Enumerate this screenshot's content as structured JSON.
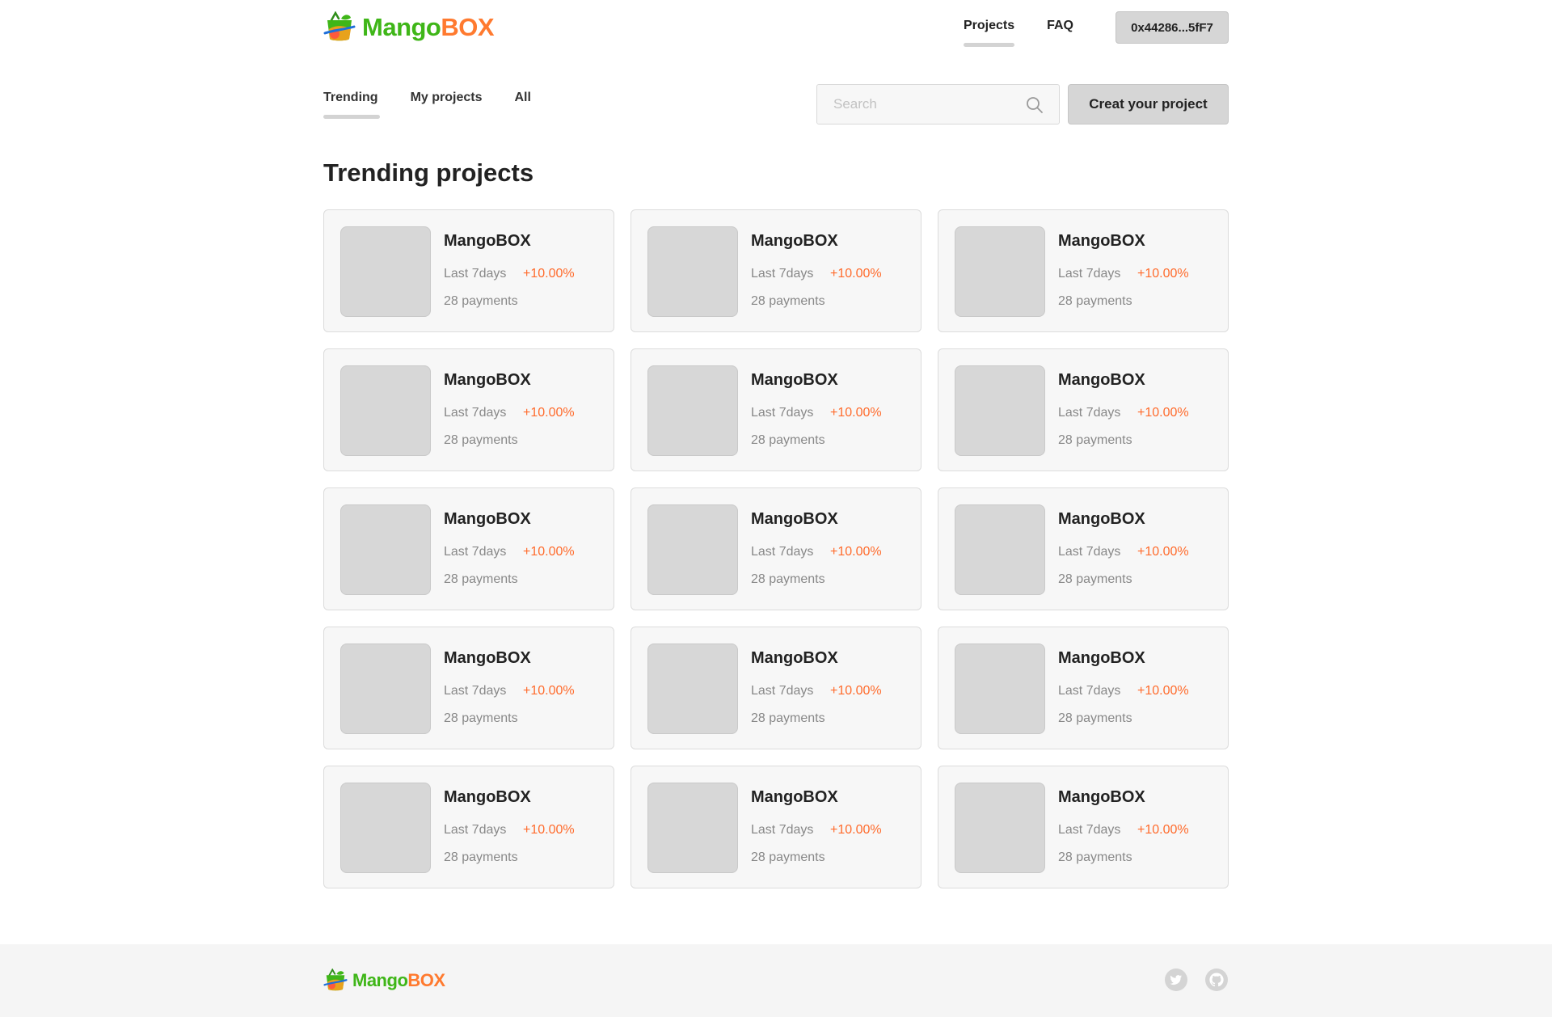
{
  "brand": {
    "name_part1": "Mango",
    "name_part2": "BOX",
    "accent_green": "#3fb618",
    "accent_orange": "#ff7a2f"
  },
  "nav": {
    "projects_label": "Projects",
    "faq_label": "FAQ",
    "wallet_label": "0x44286...5fF7"
  },
  "toolbar": {
    "tabs": [
      {
        "label": "Trending",
        "active": true
      },
      {
        "label": "My projects",
        "active": false
      },
      {
        "label": "All",
        "active": false
      }
    ],
    "search_placeholder": "Search",
    "search_value": "",
    "create_label": "Creat your project"
  },
  "main": {
    "title": "Trending projects",
    "projects": [
      {
        "name": "MangoBOX",
        "period": "Last 7days",
        "change": "+10.00%",
        "payments": "28 payments"
      },
      {
        "name": "MangoBOX",
        "period": "Last 7days",
        "change": "+10.00%",
        "payments": "28 payments"
      },
      {
        "name": "MangoBOX",
        "period": "Last 7days",
        "change": "+10.00%",
        "payments": "28 payments"
      },
      {
        "name": "MangoBOX",
        "period": "Last 7days",
        "change": "+10.00%",
        "payments": "28 payments"
      },
      {
        "name": "MangoBOX",
        "period": "Last 7days",
        "change": "+10.00%",
        "payments": "28 payments"
      },
      {
        "name": "MangoBOX",
        "period": "Last 7days",
        "change": "+10.00%",
        "payments": "28 payments"
      },
      {
        "name": "MangoBOX",
        "period": "Last 7days",
        "change": "+10.00%",
        "payments": "28 payments"
      },
      {
        "name": "MangoBOX",
        "period": "Last 7days",
        "change": "+10.00%",
        "payments": "28 payments"
      },
      {
        "name": "MangoBOX",
        "period": "Last 7days",
        "change": "+10.00%",
        "payments": "28 payments"
      },
      {
        "name": "MangoBOX",
        "period": "Last 7days",
        "change": "+10.00%",
        "payments": "28 payments"
      },
      {
        "name": "MangoBOX",
        "period": "Last 7days",
        "change": "+10.00%",
        "payments": "28 payments"
      },
      {
        "name": "MangoBOX",
        "period": "Last 7days",
        "change": "+10.00%",
        "payments": "28 payments"
      },
      {
        "name": "MangoBOX",
        "period": "Last 7days",
        "change": "+10.00%",
        "payments": "28 payments"
      },
      {
        "name": "MangoBOX",
        "period": "Last 7days",
        "change": "+10.00%",
        "payments": "28 payments"
      },
      {
        "name": "MangoBOX",
        "period": "Last 7days",
        "change": "+10.00%",
        "payments": "28 payments"
      }
    ]
  },
  "footer": {
    "social": [
      "twitter-icon",
      "github-icon"
    ]
  }
}
